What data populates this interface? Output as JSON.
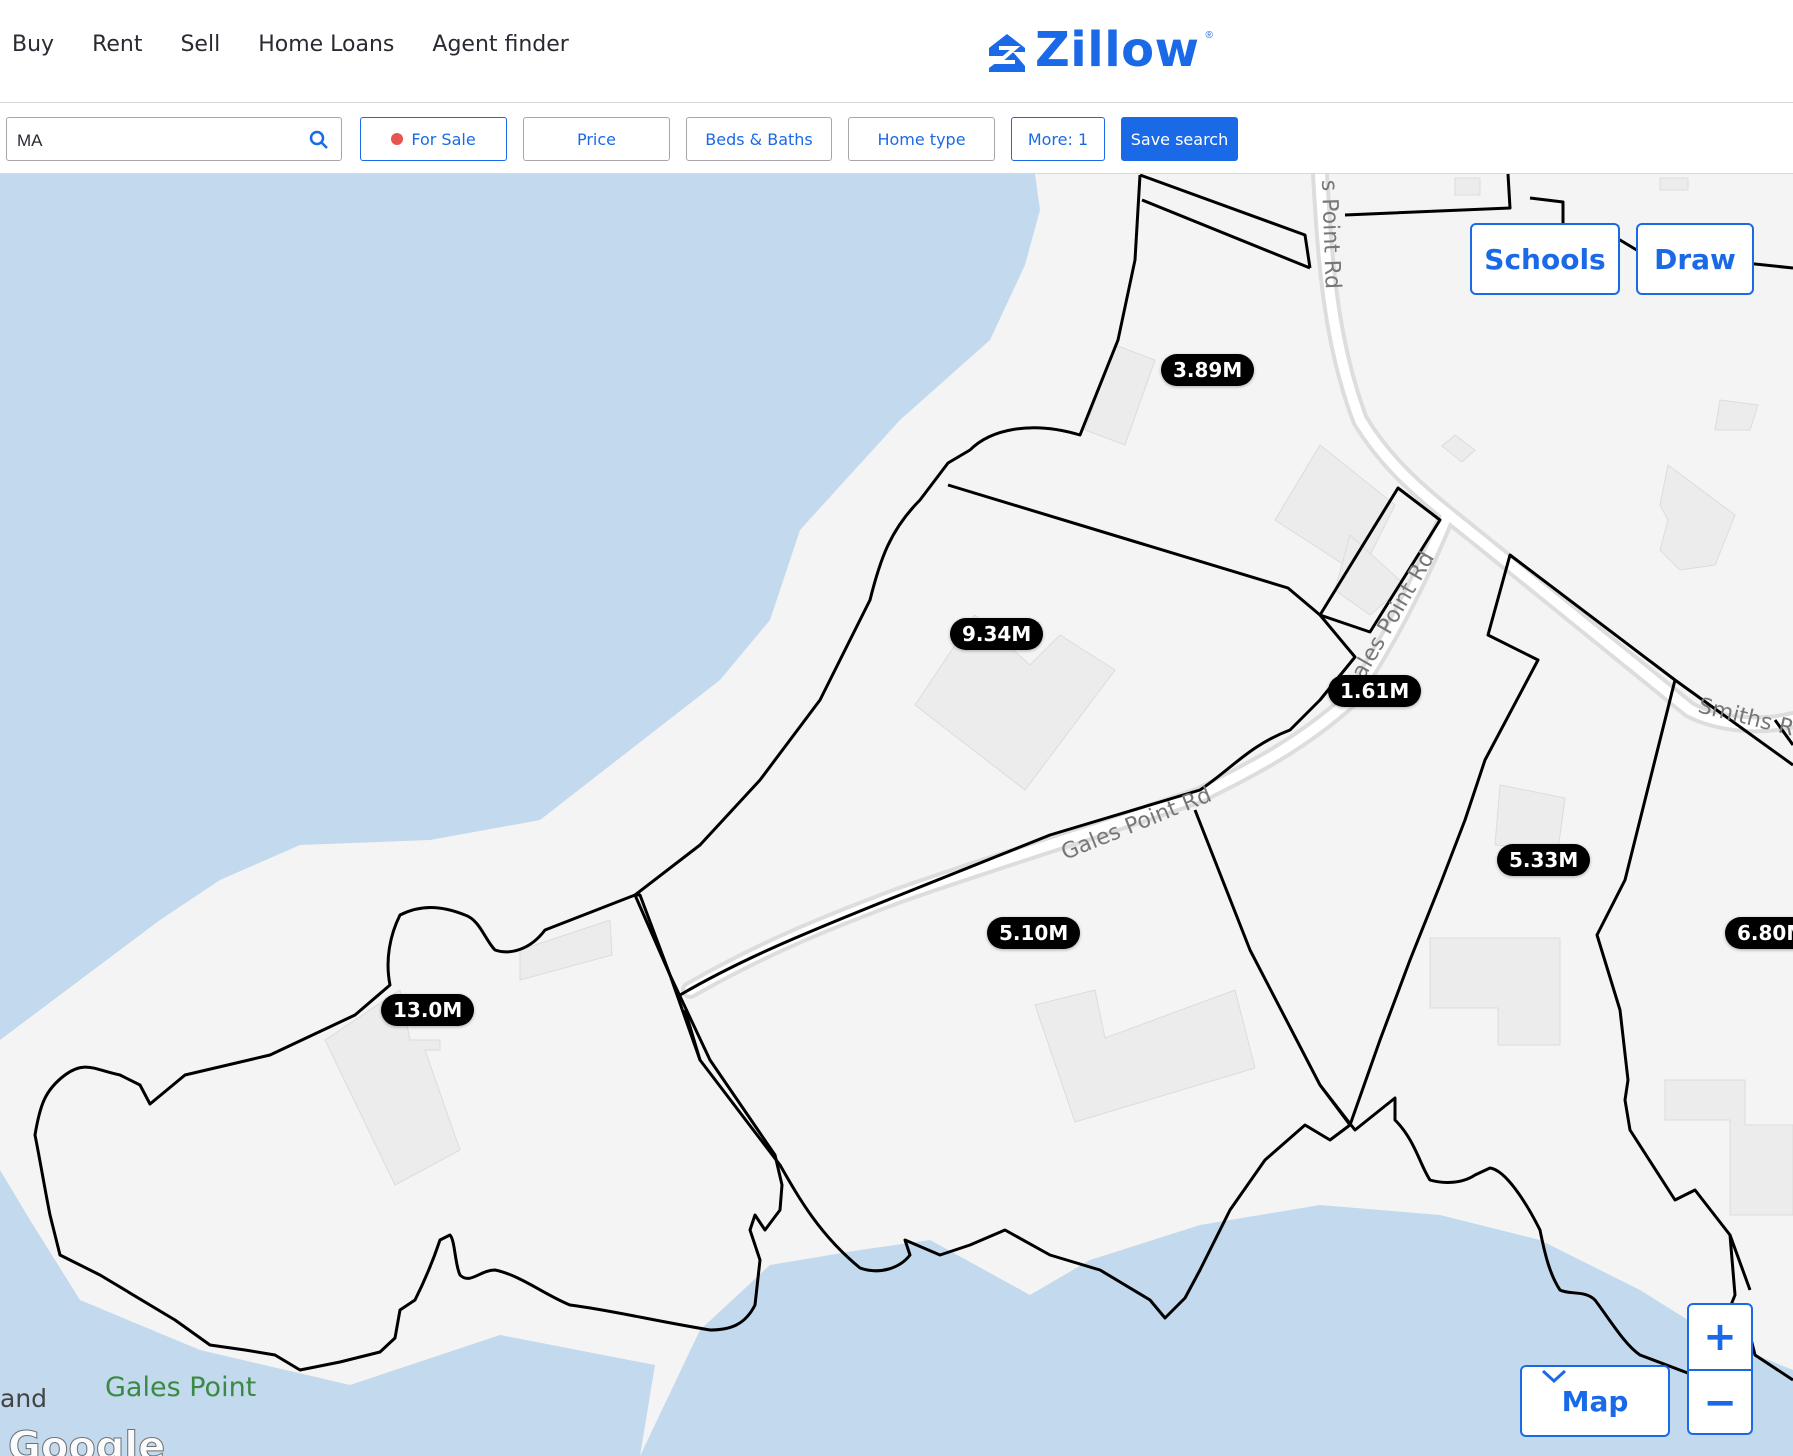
{
  "nav": {
    "items": [
      "Buy",
      "Rent",
      "Sell",
      "Home Loans",
      "Agent finder"
    ],
    "logo_text": "Zillow",
    "logo_mark": "®"
  },
  "filters": {
    "search_value": "MA",
    "for_sale": "For Sale",
    "price": "Price",
    "beds_baths": "Beds & Baths",
    "home_type": "Home type",
    "more": "More: 1",
    "save_search": "Save search"
  },
  "map": {
    "schools": "Schools",
    "draw": "Draw",
    "map_type": "Map",
    "zoom_in": "+",
    "zoom_out": "−",
    "roads": [
      "s Point Rd",
      "Gales Point Rd",
      "Gales Point Rd",
      "Smiths R"
    ],
    "place_labels": [
      "Gales Point",
      "and"
    ],
    "attribution": "Google"
  },
  "listings": [
    {
      "price": "3.89M"
    },
    {
      "price": "9.34M"
    },
    {
      "price": "1.61M"
    },
    {
      "price": "5.33M"
    },
    {
      "price": "5.10M"
    },
    {
      "price": "13.0M"
    },
    {
      "price": "6.80M"
    }
  ],
  "colors": {
    "accent": "#1a6ae8",
    "water": "#c3d9ed",
    "land": "#f4f4f4",
    "for_sale_dot": "#e8554e"
  }
}
